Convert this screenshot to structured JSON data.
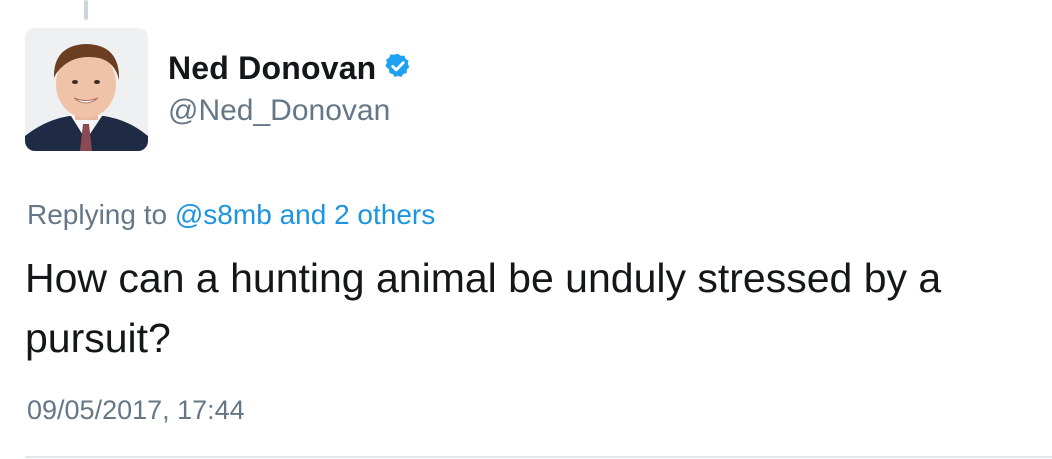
{
  "author": {
    "display_name": "Ned Donovan",
    "handle": "@Ned_Donovan",
    "verified_icon": "verified-badge-icon",
    "avatar_icon": "profile-photo"
  },
  "reply": {
    "prefix": "Replying to",
    "mention": "@s8mb",
    "connector": "and",
    "others": "2 others"
  },
  "tweet": {
    "text": "How can a hunting animal be unduly stressed by a pursuit?",
    "timestamp": "09/05/2017, 17:44"
  },
  "colors": {
    "accent": "#1b95e0",
    "verified": "#1da1f2",
    "secondary_text": "#657786",
    "primary_text": "#14171a"
  }
}
